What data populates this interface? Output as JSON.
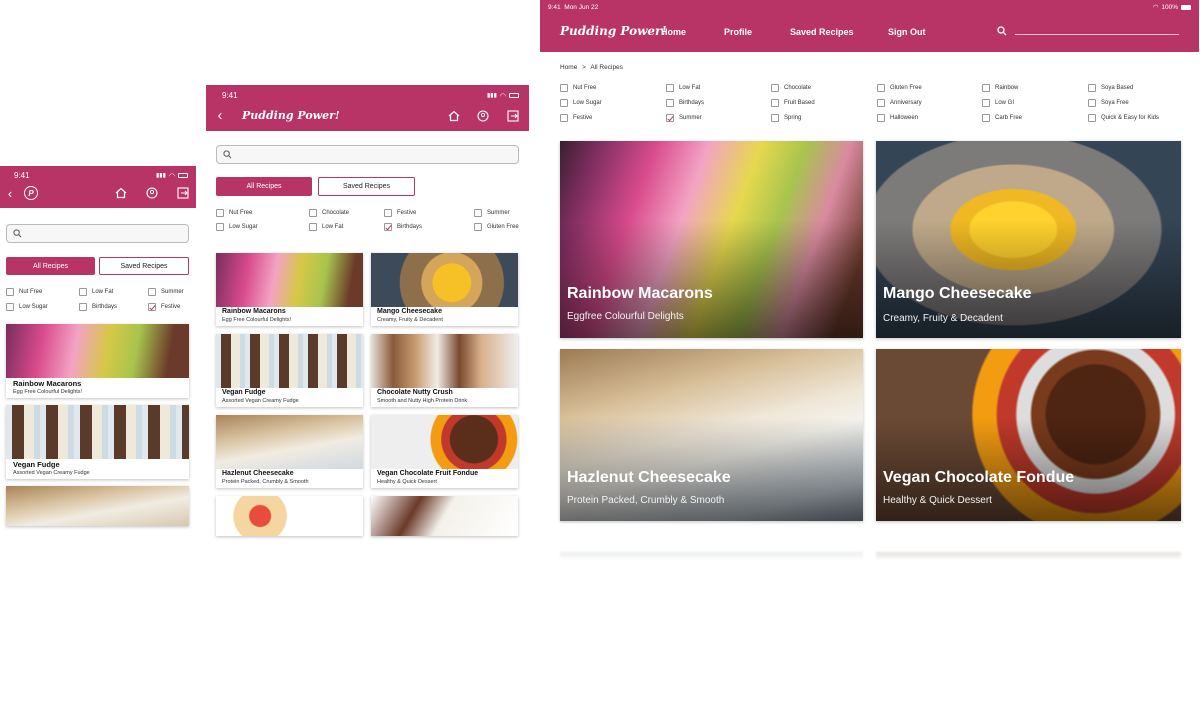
{
  "app": {
    "title": "Pudding Power!",
    "time_phone": "9:41",
    "time_tablet": "9:41",
    "time_desktop": "9:41",
    "date_desktop": "Mon Jun 22",
    "battery": "100%"
  },
  "nav": {
    "home": "Home",
    "profile": "Profile",
    "saved": "Saved Recipes",
    "signout": "Sign Out"
  },
  "breadcrumb": {
    "home": "Home",
    "sep": ">",
    "current": "All Recipes"
  },
  "tabs": {
    "all": "All Recipes",
    "saved": "Saved Recipes"
  },
  "filters": {
    "phone": [
      {
        "label": "Nut Free",
        "checked": false
      },
      {
        "label": "Low Fat",
        "checked": false
      },
      {
        "label": "Summer",
        "checked": false
      },
      {
        "label": "Low Sugar",
        "checked": false
      },
      {
        "label": "Birthdays",
        "checked": false
      },
      {
        "label": "Festive",
        "checked": true
      }
    ],
    "tablet": [
      {
        "label": "Nut Free",
        "checked": false
      },
      {
        "label": "Chocolate",
        "checked": false
      },
      {
        "label": "Festive",
        "checked": false
      },
      {
        "label": "Summer",
        "checked": false
      },
      {
        "label": "Low Sugar",
        "checked": false
      },
      {
        "label": "Low Fat",
        "checked": false
      },
      {
        "label": "Birthdays",
        "checked": true
      },
      {
        "label": "Gluten Free",
        "checked": false
      }
    ],
    "desktop": [
      {
        "label": "Nut Free",
        "checked": false
      },
      {
        "label": "Low Fat",
        "checked": false
      },
      {
        "label": "Chocolate",
        "checked": false
      },
      {
        "label": "Gluten Free",
        "checked": false
      },
      {
        "label": "Rainbow",
        "checked": false
      },
      {
        "label": "Soya Based",
        "checked": false
      },
      {
        "label": "Low Sugar",
        "checked": false
      },
      {
        "label": "Birthdays",
        "checked": false
      },
      {
        "label": "Fruit Based",
        "checked": false
      },
      {
        "label": "Anniversary",
        "checked": false
      },
      {
        "label": "Low GI",
        "checked": false
      },
      {
        "label": "Soya Free",
        "checked": false
      },
      {
        "label": "Festive",
        "checked": false
      },
      {
        "label": "Summer",
        "checked": true
      },
      {
        "label": "Spring",
        "checked": false
      },
      {
        "label": "Halloween",
        "checked": false
      },
      {
        "label": "Carb Free",
        "checked": false
      },
      {
        "label": "Quick & Easy for Kids",
        "checked": false
      }
    ]
  },
  "recipes": {
    "rainbow": {
      "title": "Rainbow Macarons",
      "small": "Egg Free Colourful Delights!",
      "big": "Eggfree Colourful Delights"
    },
    "mango": {
      "title": "Mango Cheesecake",
      "small": "Creamy, Fruity & Decadent",
      "big": "Creamy, Fruity & Decadent"
    },
    "fudge": {
      "title": "Vegan Fudge",
      "small": "Assorted Vegan Creamy Fudge"
    },
    "choc": {
      "title": "Chocolate Nutty Crush",
      "small": "Smooth and Nutty High Protein Drink"
    },
    "hazel": {
      "title": "Hazlenut Cheesecake",
      "small": "Protein Packed, Crumbly & Smooth",
      "big": "Protein Packed, Crumbly & Smooth"
    },
    "fondue": {
      "title": "Vegan Chocolate Fruit Fondue",
      "big_title": "Vegan Chocolate Fondue",
      "small": "Healthy & Quick Dessert",
      "big": "Healthy & Quick Dessert"
    }
  },
  "colors": {
    "brand": "#b93466"
  },
  "icons": [
    "back-icon",
    "logo-icon",
    "home-icon",
    "profile-icon",
    "signout-icon",
    "search-icon",
    "signal-icon",
    "wifi-icon",
    "battery-icon"
  ]
}
